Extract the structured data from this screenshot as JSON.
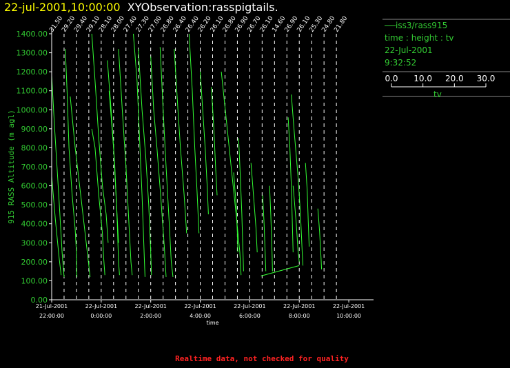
{
  "header": {
    "date": "22-jul-2001,10:00:00",
    "title": "XYObservation:rasspigtails."
  },
  "legend": {
    "series": "iss3/rass915",
    "axes": "time : height : tv",
    "date": "22-Jul-2001",
    "time": "9:32:52",
    "scale_ticks": [
      "0.0",
      "10.0",
      "20.0",
      "30.0"
    ],
    "scale_label": "tv"
  },
  "footer": {
    "warning": "Realtime data, not checked for quality"
  },
  "colors": {
    "trace": "#33ff33",
    "axis": "#ffffff",
    "label": "#33cc33",
    "warning": "#ff2222",
    "date": "#ffff00"
  },
  "chart_data": {
    "type": "line",
    "ylabel": "915 RASS Altitude (m agl)",
    "xlabel": "time",
    "ylim": [
      0,
      1400
    ],
    "yticks": [
      "0.00",
      "100.00",
      "200.00",
      "300.00",
      "400.00",
      "500.00",
      "600.00",
      "700.00",
      "800.00",
      "900.00",
      "1000.00",
      "1100.00",
      "1200.00",
      "1300.00",
      "1400.00"
    ],
    "x_range_hours": [
      0,
      13
    ],
    "xticks": [
      {
        "h": 0,
        "date": "21-Jul-2001",
        "time": "22:00:00"
      },
      {
        "h": 2,
        "date": "22-Jul-2001",
        "time": "0:00:00"
      },
      {
        "h": 4,
        "date": "22-Jul-2001",
        "time": "2:00:00"
      },
      {
        "h": 6,
        "date": "22-Jul-2001",
        "time": "4:00:00"
      },
      {
        "h": 8,
        "date": "22-Jul-2001",
        "time": "6:00:00"
      },
      {
        "h": 10,
        "date": "22-Jul-2001",
        "time": "8:00:00"
      },
      {
        "h": 12,
        "date": "22-Jul-2001",
        "time": "10:00:00"
      }
    ],
    "profile_labels": [
      "31.50",
      "29.20",
      "29.40",
      "29.10",
      "28.10",
      "28.00",
      "27.40",
      "27.30",
      "27.00",
      "26.80",
      "26.40",
      "26.40",
      "26.20",
      "26.10",
      "26.80",
      "26.90",
      "26.70",
      "26.10",
      "14.60",
      "26.90",
      "26.10",
      "25.30",
      "24.80",
      "21.80"
    ],
    "profile_times_h": [
      0.0,
      0.5,
      1.0,
      1.5,
      2.0,
      2.5,
      3.0,
      3.5,
      4.0,
      4.5,
      5.0,
      5.5,
      6.0,
      6.5,
      7.0,
      7.5,
      8.0,
      8.5,
      9.0,
      9.5,
      10.0,
      10.5,
      11.0,
      11.5
    ],
    "traces": [
      [
        [
          0.0,
          1180
        ],
        [
          0.12,
          900
        ],
        [
          0.28,
          560
        ],
        [
          0.42,
          250
        ],
        [
          0.5,
          120
        ]
      ],
      [
        [
          0.0,
          650
        ],
        [
          0.15,
          420
        ],
        [
          0.3,
          220
        ],
        [
          0.38,
          130
        ]
      ],
      [
        [
          0.55,
          1320
        ],
        [
          0.62,
          1100
        ],
        [
          0.7,
          800
        ],
        [
          0.82,
          560
        ],
        [
          0.95,
          370
        ],
        [
          1.0,
          250
        ],
        [
          1.02,
          120
        ]
      ],
      [
        [
          0.75,
          1070
        ],
        [
          0.95,
          800
        ],
        [
          1.2,
          520
        ],
        [
          1.5,
          180
        ],
        [
          1.55,
          120
        ]
      ],
      [
        [
          1.62,
          900
        ],
        [
          1.75,
          800
        ],
        [
          1.9,
          550
        ],
        [
          2.05,
          350
        ],
        [
          2.1,
          220
        ],
        [
          2.15,
          130
        ]
      ],
      [
        [
          1.62,
          1400
        ],
        [
          1.78,
          1100
        ],
        [
          1.9,
          850
        ],
        [
          2.05,
          600
        ],
        [
          2.2,
          450
        ],
        [
          2.28,
          300
        ]
      ],
      [
        [
          2.25,
          1260
        ],
        [
          2.4,
          1000
        ],
        [
          2.55,
          700
        ],
        [
          2.65,
          400
        ],
        [
          2.7,
          200
        ],
        [
          2.74,
          130
        ]
      ],
      [
        [
          2.32,
          1100
        ],
        [
          2.5,
          800
        ],
        [
          2.62,
          500
        ],
        [
          2.7,
          300
        ]
      ],
      [
        [
          2.7,
          1320
        ],
        [
          2.85,
          1000
        ],
        [
          3.0,
          700
        ],
        [
          3.12,
          400
        ],
        [
          3.2,
          200
        ],
        [
          3.25,
          130
        ]
      ],
      [
        [
          3.3,
          1400
        ],
        [
          3.45,
          1150
        ],
        [
          3.55,
          850
        ],
        [
          3.65,
          550
        ],
        [
          3.72,
          300
        ],
        [
          3.77,
          120
        ]
      ],
      [
        [
          3.5,
          1320
        ],
        [
          3.65,
          1000
        ],
        [
          3.8,
          750
        ],
        [
          3.92,
          500
        ],
        [
          4.0,
          250
        ],
        [
          4.03,
          130
        ]
      ],
      [
        [
          4.0,
          1280
        ],
        [
          4.12,
          1000
        ],
        [
          4.25,
          800
        ],
        [
          4.4,
          550
        ],
        [
          4.55,
          280
        ],
        [
          4.62,
          120
        ]
      ],
      [
        [
          4.38,
          1330
        ],
        [
          4.5,
          1000
        ],
        [
          4.62,
          700
        ],
        [
          4.75,
          400
        ],
        [
          4.83,
          200
        ],
        [
          4.9,
          120
        ]
      ],
      [
        [
          4.95,
          1320
        ],
        [
          5.1,
          1000
        ],
        [
          5.2,
          800
        ],
        [
          5.35,
          550
        ],
        [
          5.45,
          350
        ]
      ],
      [
        [
          5.55,
          1400
        ],
        [
          5.68,
          1100
        ],
        [
          5.78,
          800
        ],
        [
          5.88,
          550
        ],
        [
          5.95,
          350
        ]
      ],
      [
        [
          6.0,
          1200
        ],
        [
          6.1,
          1000
        ],
        [
          6.2,
          800
        ],
        [
          6.28,
          600
        ],
        [
          6.33,
          450
        ]
      ],
      [
        [
          6.45,
          1120
        ],
        [
          6.55,
          900
        ],
        [
          6.62,
          700
        ],
        [
          6.68,
          550
        ]
      ],
      [
        [
          6.85,
          1200
        ],
        [
          7.05,
          950
        ],
        [
          7.25,
          700
        ],
        [
          7.45,
          450
        ],
        [
          7.6,
          250
        ],
        [
          7.65,
          130
        ]
      ],
      [
        [
          7.35,
          670
        ],
        [
          7.45,
          500
        ],
        [
          7.5,
          350
        ],
        [
          7.52,
          250
        ]
      ],
      [
        [
          7.55,
          850
        ],
        [
          7.62,
          650
        ],
        [
          7.68,
          450
        ],
        [
          7.72,
          280
        ],
        [
          7.75,
          150
        ]
      ],
      [
        [
          8.05,
          720
        ],
        [
          8.15,
          550
        ],
        [
          8.25,
          380
        ],
        [
          8.3,
          250
        ]
      ],
      [
        [
          8.52,
          550
        ],
        [
          8.58,
          400
        ],
        [
          8.62,
          250
        ],
        [
          8.65,
          150
        ]
      ],
      [
        [
          8.8,
          600
        ],
        [
          8.85,
          450
        ],
        [
          8.9,
          250
        ],
        [
          8.92,
          150
        ]
      ],
      [
        [
          9.55,
          960
        ],
        [
          9.62,
          800
        ],
        [
          9.68,
          600
        ],
        [
          9.72,
          400
        ],
        [
          9.75,
          250
        ]
      ],
      [
        [
          9.68,
          1080
        ],
        [
          9.8,
          880
        ],
        [
          9.95,
          650
        ],
        [
          10.05,
          450
        ],
        [
          10.12,
          250
        ],
        [
          10.15,
          180
        ]
      ],
      [
        [
          9.75,
          600
        ],
        [
          9.88,
          400
        ],
        [
          9.95,
          260
        ],
        [
          10.0,
          200
        ]
      ],
      [
        [
          10.25,
          720
        ],
        [
          10.32,
          580
        ],
        [
          10.36,
          420
        ],
        [
          10.4,
          280
        ]
      ],
      [
        [
          10.75,
          480
        ],
        [
          10.82,
          360
        ],
        [
          10.88,
          220
        ],
        [
          10.9,
          160
        ]
      ],
      [
        [
          8.45,
          125
        ],
        [
          10.0,
          180
        ]
      ]
    ]
  }
}
